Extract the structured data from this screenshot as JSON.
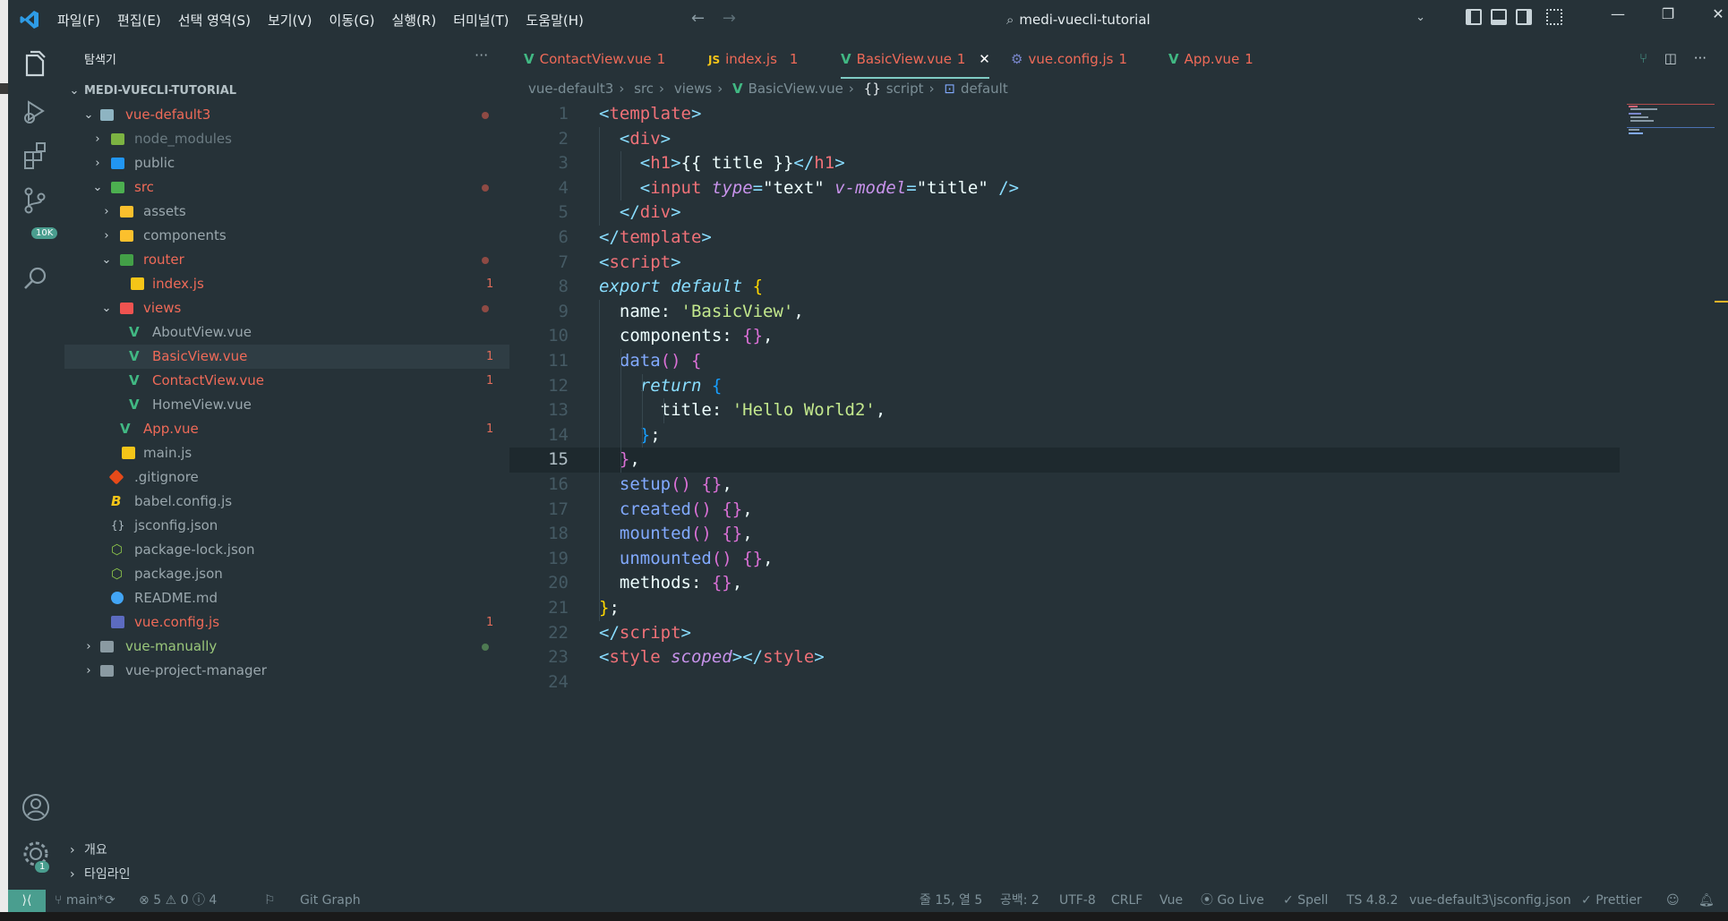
{
  "titlebar": {
    "menus": [
      "파일(F)",
      "편집(E)",
      "선택 영역(S)",
      "보기(V)",
      "이동(G)",
      "실행(R)",
      "터미널(T)",
      "도움말(H)"
    ],
    "search_text": "medi-vuecli-tutorial"
  },
  "activity": {
    "scm_badge": "10K",
    "settings_badge": "1"
  },
  "sidebar": {
    "title": "탐색기",
    "root": "MEDI-VUECLI-TUTORIAL",
    "items": [
      {
        "label": "vue-default3",
        "num": ""
      },
      {
        "label": "node_modules",
        "num": ""
      },
      {
        "label": "public",
        "num": ""
      },
      {
        "label": "src",
        "num": ""
      },
      {
        "label": "assets",
        "num": ""
      },
      {
        "label": "components",
        "num": ""
      },
      {
        "label": "router",
        "num": ""
      },
      {
        "label": "index.js",
        "num": "1"
      },
      {
        "label": "views",
        "num": ""
      },
      {
        "label": "AboutView.vue",
        "num": ""
      },
      {
        "label": "BasicView.vue",
        "num": "1"
      },
      {
        "label": "ContactView.vue",
        "num": "1"
      },
      {
        "label": "HomeView.vue",
        "num": ""
      },
      {
        "label": "App.vue",
        "num": "1"
      },
      {
        "label": "main.js",
        "num": ""
      },
      {
        "label": ".gitignore",
        "num": ""
      },
      {
        "label": "babel.config.js",
        "num": ""
      },
      {
        "label": "jsconfig.json",
        "num": ""
      },
      {
        "label": "package-lock.json",
        "num": ""
      },
      {
        "label": "package.json",
        "num": ""
      },
      {
        "label": "README.md",
        "num": ""
      },
      {
        "label": "vue.config.js",
        "num": "1"
      },
      {
        "label": "vue-manually",
        "num": ""
      },
      {
        "label": "vue-project-manager",
        "num": ""
      }
    ],
    "outline": "개요",
    "timeline": "타임라인"
  },
  "tabs": [
    {
      "label": "ContactView.vue",
      "count": "1"
    },
    {
      "label": "index.js",
      "count": "1"
    },
    {
      "label": "BasicView.vue",
      "count": "1"
    },
    {
      "label": "vue.config.js",
      "count": "1"
    },
    {
      "label": "App.vue",
      "count": "1"
    }
  ],
  "breadcrumb": [
    "vue-default3",
    "src",
    "views",
    "BasicView.vue",
    "script",
    "default"
  ],
  "editor": {
    "current_line": 15,
    "lines": [
      [
        [
          "<",
          "p"
        ],
        [
          "template",
          "t"
        ],
        [
          ">",
          "p"
        ]
      ],
      [
        [
          "  ",
          ""
        ],
        [
          "<",
          "p"
        ],
        [
          "div",
          "t"
        ],
        [
          ">",
          "p"
        ]
      ],
      [
        [
          "    ",
          ""
        ],
        [
          "<",
          "p"
        ],
        [
          "h1",
          "t"
        ],
        [
          ">",
          "p"
        ],
        [
          "{{ title }}",
          "w"
        ],
        [
          "</",
          "p"
        ],
        [
          "h1",
          "t"
        ],
        [
          ">",
          "p"
        ]
      ],
      [
        [
          "    ",
          ""
        ],
        [
          "<",
          "p"
        ],
        [
          "input",
          "t"
        ],
        [
          " ",
          ""
        ],
        [
          "type",
          "ia"
        ],
        [
          "=",
          "p"
        ],
        [
          "\"text\"",
          "w"
        ],
        [
          " ",
          ""
        ],
        [
          "v-model",
          "ia"
        ],
        [
          "=",
          "p"
        ],
        [
          "\"title\"",
          "w"
        ],
        [
          " />",
          "p"
        ]
      ],
      [
        [
          "  ",
          ""
        ],
        [
          "</",
          "p"
        ],
        [
          "div",
          "t"
        ],
        [
          ">",
          "p"
        ]
      ],
      [
        [
          "</",
          "p"
        ],
        [
          "template",
          "t"
        ],
        [
          ">",
          "p"
        ]
      ],
      [
        [
          "<",
          "p"
        ],
        [
          "script",
          "t"
        ],
        [
          ">",
          "p"
        ]
      ],
      [
        [
          "export default",
          "kw"
        ],
        [
          " ",
          ""
        ],
        [
          "{",
          "b1"
        ]
      ],
      [
        [
          "  name: ",
          "w"
        ],
        [
          "'BasicView'",
          "s"
        ],
        [
          ",",
          "w"
        ]
      ],
      [
        [
          "  components: ",
          "w"
        ],
        [
          "{}",
          "b2"
        ],
        [
          ",",
          "w"
        ]
      ],
      [
        [
          "  ",
          ""
        ],
        [
          "data",
          "f"
        ],
        [
          "()",
          "b2"
        ],
        [
          " ",
          ""
        ],
        [
          "{",
          "b2"
        ]
      ],
      [
        [
          "    ",
          ""
        ],
        [
          "return",
          "kw"
        ],
        [
          " ",
          ""
        ],
        [
          "{",
          "b3"
        ]
      ],
      [
        [
          "      title: ",
          "w"
        ],
        [
          "'Hello World2'",
          "s"
        ],
        [
          ",",
          "w"
        ]
      ],
      [
        [
          "    ",
          ""
        ],
        [
          "}",
          "b3"
        ],
        [
          ";",
          "w"
        ]
      ],
      [
        [
          "  ",
          ""
        ],
        [
          "}",
          "b2"
        ],
        [
          ",",
          "w"
        ]
      ],
      [
        [
          "  ",
          ""
        ],
        [
          "setup",
          "f"
        ],
        [
          "()",
          "b2"
        ],
        [
          " ",
          ""
        ],
        [
          "{}",
          "b2"
        ],
        [
          ",",
          "w"
        ]
      ],
      [
        [
          "  ",
          ""
        ],
        [
          "created",
          "f"
        ],
        [
          "()",
          "b2"
        ],
        [
          " ",
          ""
        ],
        [
          "{}",
          "b2"
        ],
        [
          ",",
          "w"
        ]
      ],
      [
        [
          "  ",
          ""
        ],
        [
          "mounted",
          "f"
        ],
        [
          "()",
          "b2"
        ],
        [
          " ",
          ""
        ],
        [
          "{}",
          "b2"
        ],
        [
          ",",
          "w"
        ]
      ],
      [
        [
          "  ",
          ""
        ],
        [
          "unmounted",
          "f"
        ],
        [
          "()",
          "b2"
        ],
        [
          " ",
          ""
        ],
        [
          "{}",
          "b2"
        ],
        [
          ",",
          "w"
        ]
      ],
      [
        [
          "  methods: ",
          "w"
        ],
        [
          "{}",
          "b2"
        ],
        [
          ",",
          "w"
        ]
      ],
      [
        [
          "}",
          "b1"
        ],
        [
          ";",
          "w"
        ]
      ],
      [
        [
          "</",
          "p"
        ],
        [
          "script",
          "t"
        ],
        [
          ">",
          "p"
        ]
      ],
      [
        [
          "<",
          "p"
        ],
        [
          "style",
          "t"
        ],
        [
          " ",
          ""
        ],
        [
          "scoped",
          "ia"
        ],
        [
          "></",
          "p"
        ],
        [
          "style",
          "t"
        ],
        [
          ">",
          "p"
        ]
      ],
      [
        [
          "",
          ""
        ]
      ]
    ]
  },
  "status": {
    "branch": "main*",
    "errors": "5",
    "warnings": "0",
    "infos": "4",
    "git_graph": "Git Graph",
    "position": "줄 15, 열 5",
    "spaces": "공백: 2",
    "encoding": "UTF-8",
    "eol": "CRLF",
    "lang": "Vue",
    "golive": "Go Live",
    "spell": "Spell",
    "ts": "TS 4.8.2",
    "jsconfig": "vue-default3\\jsconfig.json",
    "prettier": "Prettier"
  },
  "colors": {
    "accent": "#80cbc4",
    "bg": "#263238",
    "keyword": "#89ddff",
    "tag": "#f07178",
    "string": "#c3e88d",
    "func": "#82aaff",
    "bracket1": "#ffd700",
    "bracket2": "#da70d6",
    "bracket3": "#179fff",
    "vue": "#41b883"
  }
}
